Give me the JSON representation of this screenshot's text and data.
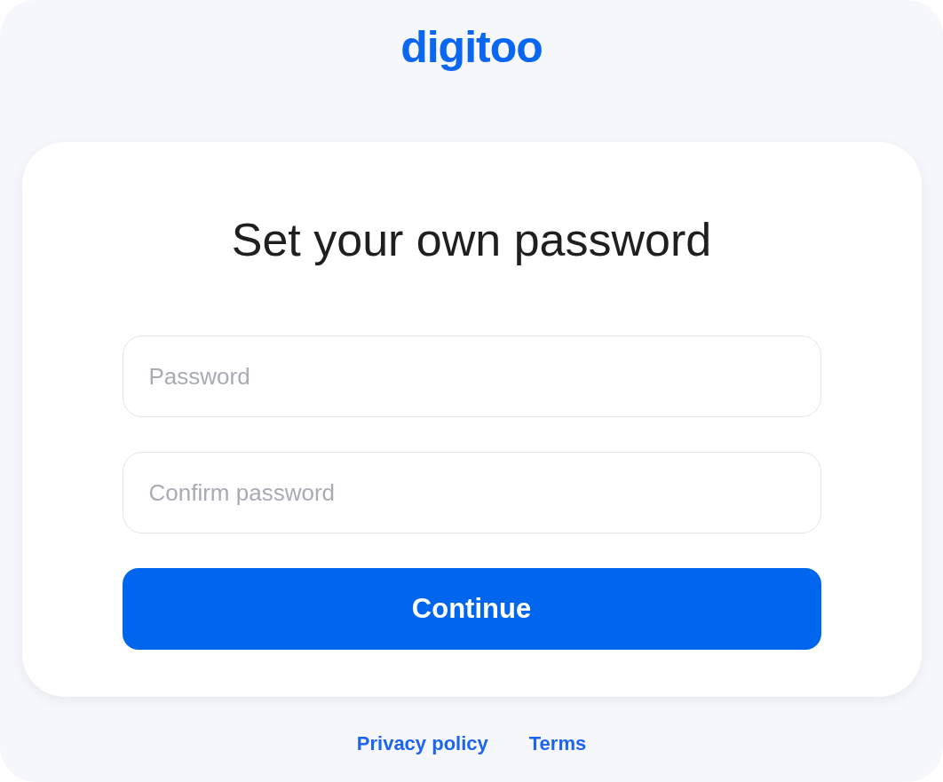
{
  "logo": "digitoo",
  "title": "Set your own password",
  "fields": [
    {
      "placeholder": "Password"
    },
    {
      "placeholder": "Confirm password"
    }
  ],
  "button": "Continue",
  "footer_links": [
    "Privacy policy",
    "Terms"
  ]
}
